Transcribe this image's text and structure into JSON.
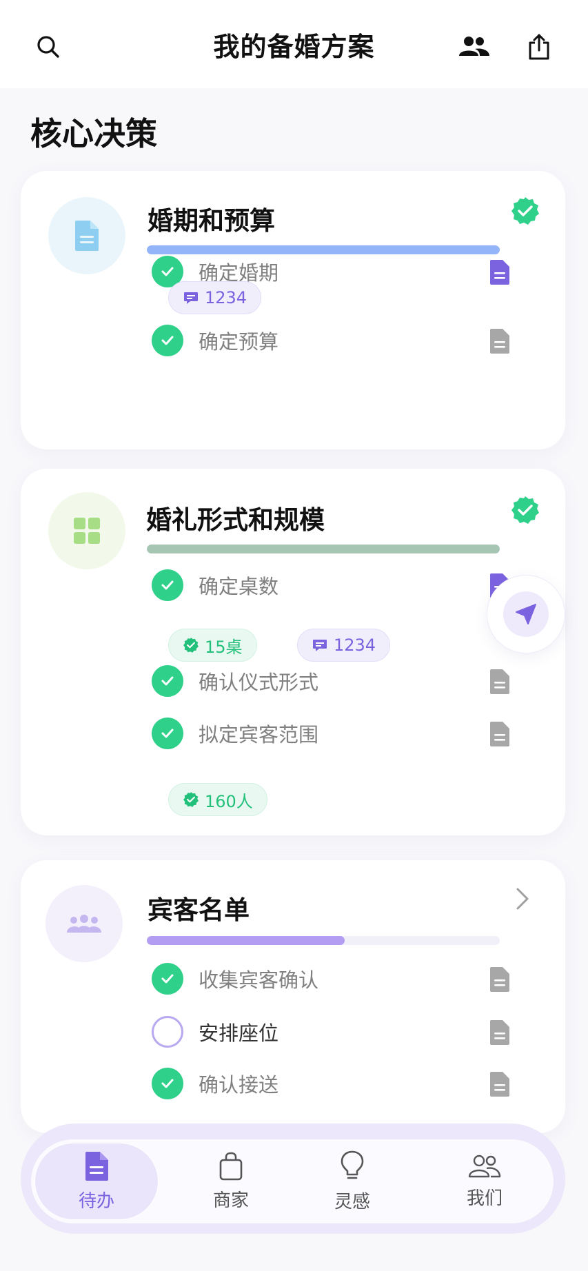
{
  "header": {
    "title": "我的备婚方案",
    "search_icon": "search-icon",
    "users_icon": "users-icon",
    "share_icon": "share-icon"
  },
  "section": {
    "title": "核心决策"
  },
  "cards": [
    {
      "title": "婚期和预算",
      "status": "completed",
      "icon": "document-icon",
      "progress": 1.0,
      "progress_color": "#93b4f8",
      "tasks": [
        {
          "label": "确定婚期",
          "done": true,
          "doc_color": "#7b63e0",
          "chips": [
            {
              "type": "comment",
              "text": "1234"
            }
          ]
        },
        {
          "label": "确定预算",
          "done": true,
          "doc_color": "#a7a7a7",
          "chips": []
        }
      ]
    },
    {
      "title": "婚礼形式和规模",
      "status": "completed",
      "icon": "grid-icon",
      "progress": 1.0,
      "progress_color": "#a6c5b3",
      "tasks": [
        {
          "label": "确定桌数",
          "done": true,
          "doc_color": "#7b63e0",
          "chips": [
            {
              "type": "verified",
              "text": "15桌"
            },
            {
              "type": "comment",
              "text": "1234"
            }
          ]
        },
        {
          "label": "确认仪式形式",
          "done": true,
          "doc_color": "#a7a7a7",
          "chips": []
        },
        {
          "label": "拟定宾客范围",
          "done": true,
          "doc_color": "#a7a7a7",
          "chips": [
            {
              "type": "verified",
              "text": "160人"
            }
          ]
        }
      ]
    },
    {
      "title": "宾客名单",
      "status": "in-progress",
      "icon": "group-icon",
      "progress": 0.56,
      "progress_color": "#b39df2",
      "tasks": [
        {
          "label": "收集宾客确认",
          "done": true,
          "doc_color": "#a7a7a7",
          "chips": []
        },
        {
          "label": "安排座位",
          "done": false,
          "doc_color": "#a7a7a7",
          "chips": []
        },
        {
          "label": "确认接送",
          "done": true,
          "doc_color": "#a7a7a7",
          "chips": []
        }
      ]
    }
  ],
  "fab": {
    "icon": "navigation-arrow-icon"
  },
  "tabbar": {
    "tabs": [
      {
        "label": "待办",
        "icon": "todo-document-icon",
        "active": true
      },
      {
        "label": "商家",
        "icon": "shopping-bag-icon",
        "active": false
      },
      {
        "label": "灵感",
        "icon": "lightbulb-icon",
        "active": false
      },
      {
        "label": "我们",
        "icon": "couple-icon",
        "active": false
      }
    ]
  }
}
